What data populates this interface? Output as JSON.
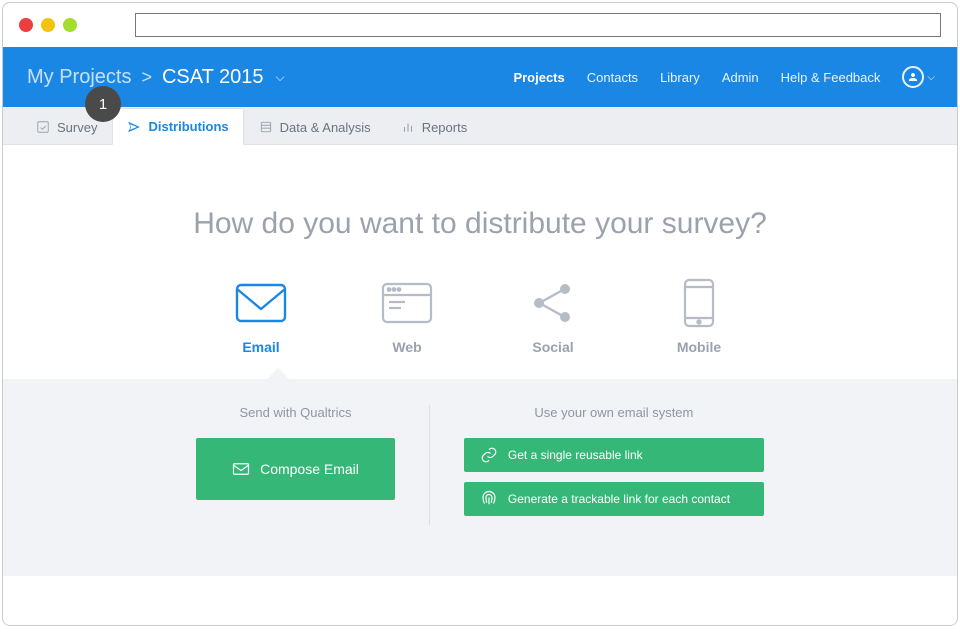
{
  "breadcrumb": {
    "root": "My Projects",
    "sep": ">",
    "current": "CSAT 2015"
  },
  "topnav": {
    "projects": "Projects",
    "contacts": "Contacts",
    "library": "Library",
    "admin": "Admin",
    "help": "Help & Feedback"
  },
  "step_badge": "1",
  "tabs": {
    "survey": "Survey",
    "distributions": "Distributions",
    "data": "Data & Analysis",
    "reports": "Reports"
  },
  "headline": "How do you want to distribute your survey?",
  "methods": {
    "email": "Email",
    "web": "Web",
    "social": "Social",
    "mobile": "Mobile"
  },
  "panel": {
    "left_title": "Send with Qualtrics",
    "compose": "Compose Email",
    "right_title": "Use your own email system",
    "single_link": "Get a single reusable link",
    "trackable_link": "Generate a trackable link for each contact"
  }
}
